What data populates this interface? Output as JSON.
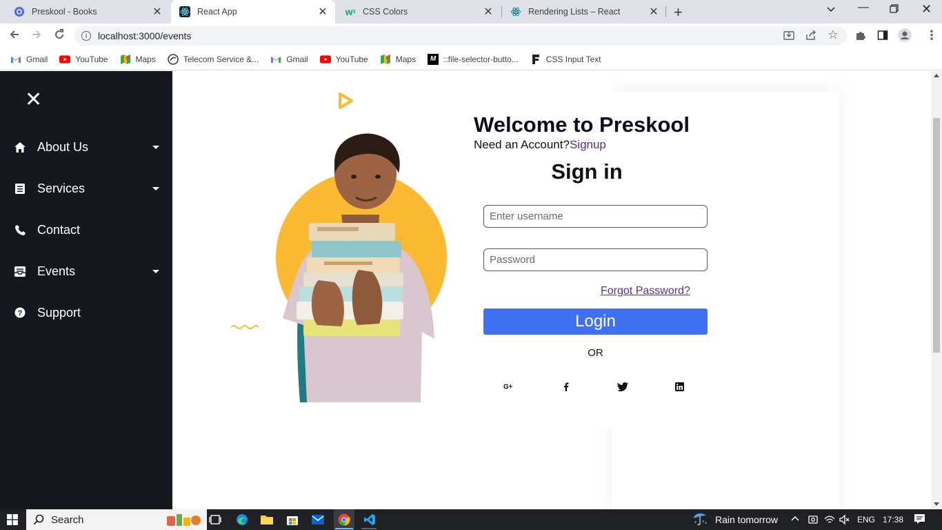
{
  "browser": {
    "tabs": [
      {
        "title": "Preskool - Books",
        "icon": "globe-icon"
      },
      {
        "title": "React App",
        "icon": "react-icon"
      },
      {
        "title": "CSS Colors",
        "icon": "w3schools-icon"
      },
      {
        "title": "Rendering Lists – React",
        "icon": "react-icon"
      }
    ],
    "url": "localhost:3000/events",
    "bookmarks": [
      {
        "label": "Gmail",
        "icon": "gmail-icon"
      },
      {
        "label": "YouTube",
        "icon": "youtube-icon"
      },
      {
        "label": "Maps",
        "icon": "maps-icon"
      },
      {
        "label": "Telecom Service &...",
        "icon": "telecom-icon"
      },
      {
        "label": "Gmail",
        "icon": "gmail-icon"
      },
      {
        "label": "YouTube",
        "icon": "youtube-icon"
      },
      {
        "label": "Maps",
        "icon": "maps-icon"
      },
      {
        "label": "::file-selector-butto...",
        "icon": "mdn-icon"
      },
      {
        "label": "CSS Input Text",
        "icon": "form-icon"
      }
    ]
  },
  "sidebar": {
    "items": [
      {
        "label": "About Us",
        "icon": "home-icon",
        "dropdown": true
      },
      {
        "label": "Services",
        "icon": "list-icon",
        "dropdown": true
      },
      {
        "label": "Contact",
        "icon": "phone-icon",
        "dropdown": false
      },
      {
        "label": "Events",
        "icon": "inbox-icon",
        "dropdown": true
      },
      {
        "label": "Support",
        "icon": "help-icon",
        "dropdown": false
      }
    ]
  },
  "login": {
    "welcome": "Welcome to Preskool",
    "need_account": "Need an Account?",
    "signup": "Signup",
    "heading": "Sign in",
    "username_placeholder": "Enter username",
    "password_placeholder": "Password",
    "forgot": "Forgot Password?",
    "login_button": "Login",
    "or": "OR",
    "social": [
      "google-plus-icon",
      "facebook-icon",
      "twitter-icon",
      "linkedin-icon"
    ]
  },
  "colors": {
    "sidebar_bg": "#16181f",
    "accent_blue": "#4070f4",
    "accent_yellow": "#fbb934",
    "link_purple": "#5b2c8a"
  },
  "taskbar": {
    "search": "Search",
    "weather": "Rain tomorrow",
    "language": "ENG",
    "time": "17:38"
  }
}
